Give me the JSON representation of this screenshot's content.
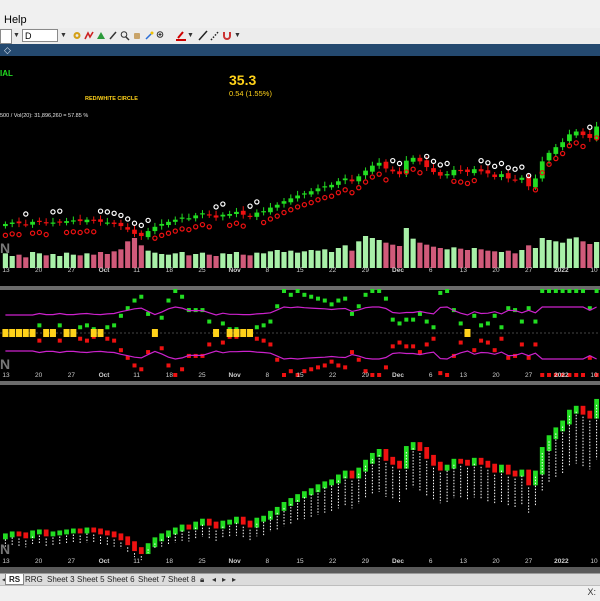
{
  "menu": {
    "help": "Help"
  },
  "toolbar": {
    "symbol_value": "",
    "period_value": "D"
  },
  "header": {
    "symbol_suffix": "IAL",
    "price": "35.3",
    "change": "0.54 (1.55%)",
    "indicator_label": "RED/WHITE CIRCLE",
    "volume_text": "500 / Vol(20): 31,896,260 = 57.85 %"
  },
  "x_axis_labels": [
    "13",
    "20",
    "27",
    "Oct",
    "11",
    "18",
    "25",
    "Nov",
    "8",
    "15",
    "22",
    "29",
    "Dec",
    "6",
    "13",
    "20",
    "27",
    "2022",
    "10"
  ],
  "x_axis_bold": [
    "Oct",
    "Nov",
    "Dec",
    "2022"
  ],
  "pane_watermark": "N",
  "sheets": [
    "RS",
    "RRG",
    "Sheet 3",
    "Sheet 5",
    "Sheet 6",
    "Sheet 7",
    "Sheet 8"
  ],
  "active_sheet": "RS",
  "status": {
    "coords": "X:"
  },
  "colors": {
    "background": "#000000",
    "up": "#22dd22",
    "down": "#ee1111",
    "price_yellow": "#ffd21a",
    "indicator_magenta": "#cc22cc",
    "volume_up": "#a8f0a8",
    "volume_down": "#d05a7a"
  },
  "chart_data": {
    "type": "candlestick",
    "description_series": [
      {
        "name": "price",
        "close": [
          21.6,
          21.8,
          21.7,
          21.5,
          21.9,
          22.0,
          21.7,
          21.8,
          21.9,
          22.0,
          22.1,
          22.0,
          22.2,
          22.1,
          21.9,
          21.8,
          21.6,
          21.3,
          20.8,
          20.2,
          19.9,
          20.6,
          21.2,
          21.6,
          21.9,
          22.2,
          22.5,
          22.4,
          22.8,
          23.1,
          22.8,
          22.5,
          22.9,
          23.0,
          23.3,
          22.9,
          22.6,
          23.2,
          23.4,
          23.9,
          24.3,
          24.8,
          25.2,
          25.6,
          25.9,
          26.2,
          26.6,
          26.9,
          27.1,
          27.6,
          28.0,
          27.6,
          28.3,
          29.1,
          29.8,
          30.2,
          29.4,
          29.0,
          28.6,
          30.5,
          30.9,
          30.4,
          29.6,
          28.9,
          28.4,
          28.6,
          29.2,
          29.1,
          28.9,
          29.3,
          29.0,
          28.7,
          28.2,
          28.6,
          28.0,
          27.8,
          28.1,
          26.9,
          28.0,
          30.4,
          31.6,
          32.4,
          33.1,
          34.2,
          34.6,
          34.1,
          33.7,
          35.3
        ]
      }
    ],
    "volume": [
      22,
      18,
      20,
      16,
      24,
      22,
      19,
      21,
      18,
      23,
      20,
      19,
      22,
      20,
      24,
      21,
      25,
      28,
      40,
      45,
      34,
      26,
      23,
      21,
      20,
      22,
      24,
      19,
      21,
      23,
      20,
      18,
      22,
      21,
      24,
      20,
      19,
      23,
      22,
      25,
      27,
      24,
      26,
      23,
      25,
      27,
      26,
      28,
      24,
      30,
      34,
      26,
      40,
      48,
      45,
      42,
      38,
      35,
      33,
      60,
      44,
      38,
      35,
      32,
      30,
      28,
      31,
      29,
      27,
      30,
      28,
      26,
      25,
      24,
      26,
      22,
      27,
      34,
      30,
      45,
      42,
      40,
      38,
      44,
      46,
      40,
      36,
      39
    ],
    "ylabel": "",
    "x_labels": [
      "13",
      "20",
      "27",
      "Oct",
      "11",
      "18",
      "25",
      "Nov",
      "8",
      "15",
      "22",
      "29",
      "Dec",
      "6",
      "13",
      "20",
      "27",
      "2022",
      "10"
    ]
  }
}
